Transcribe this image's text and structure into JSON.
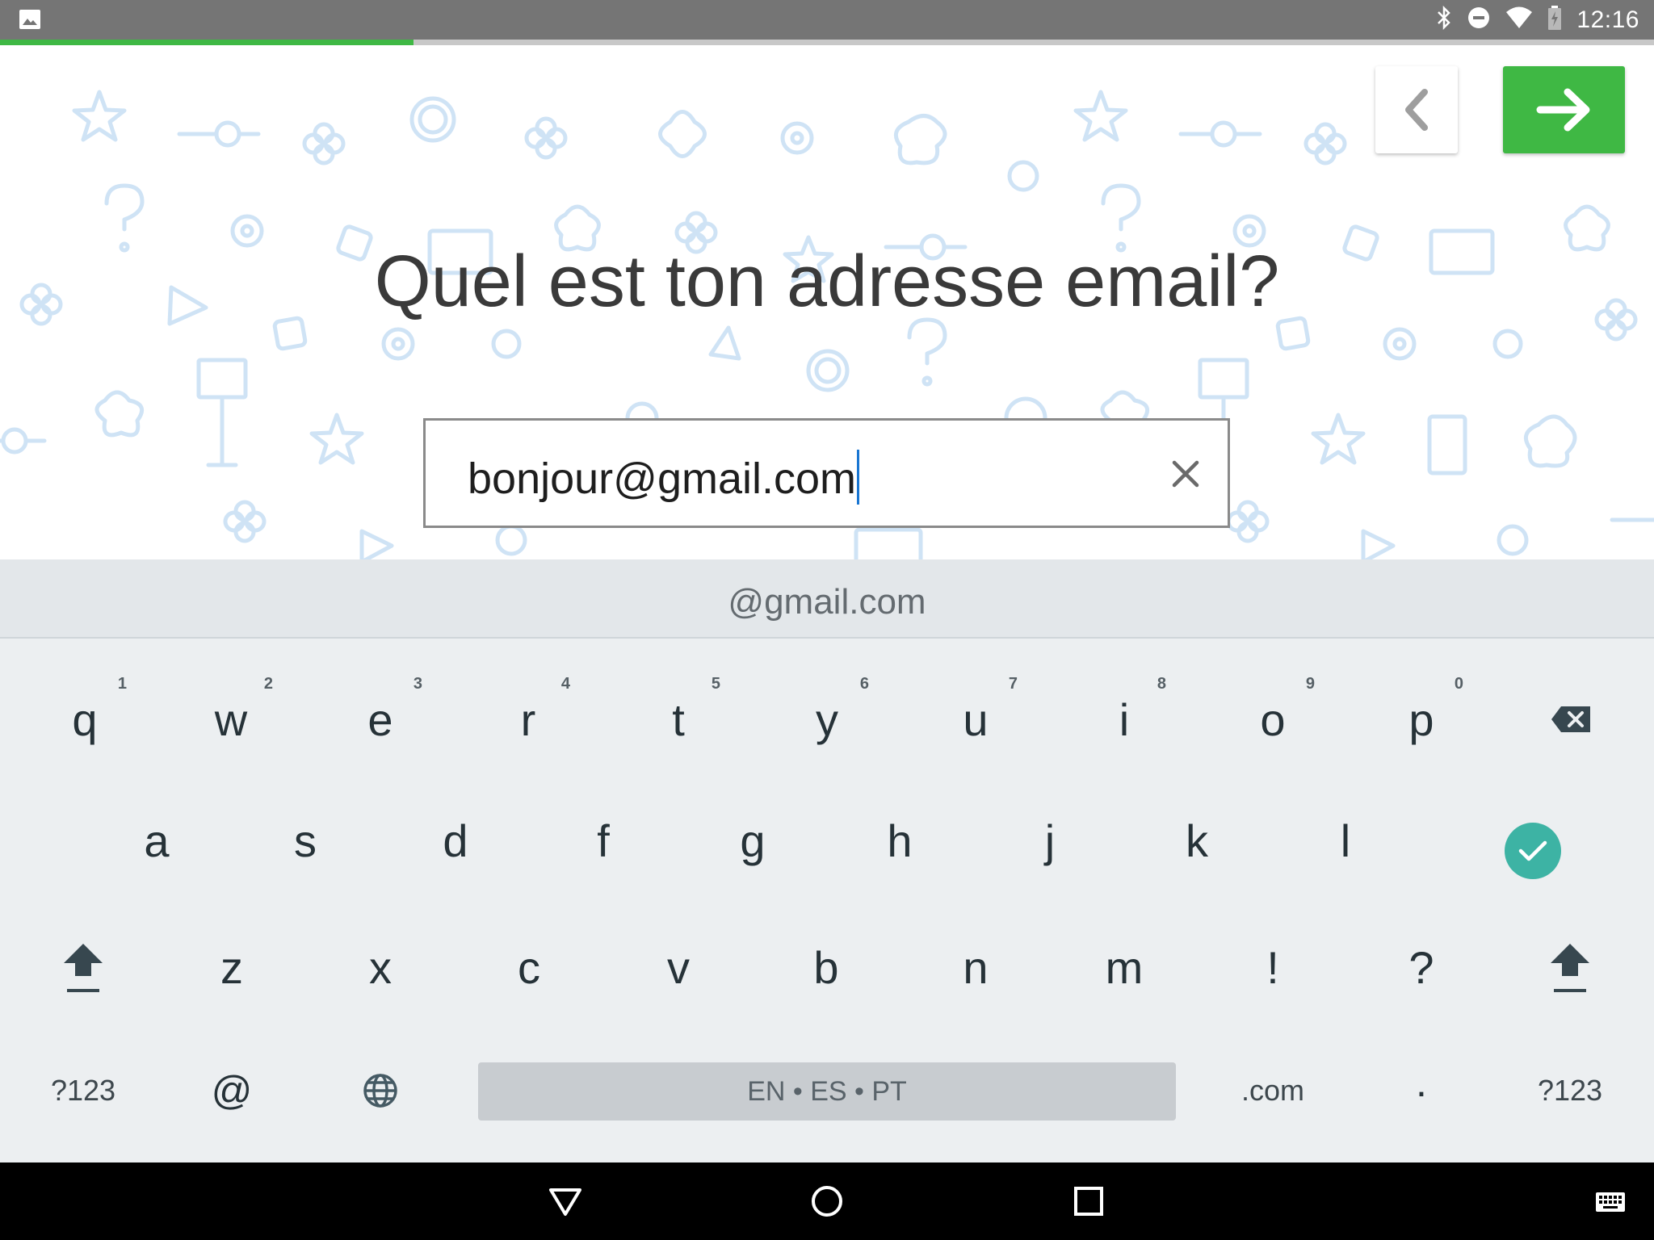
{
  "status_bar": {
    "time": "12:16",
    "icons": [
      "image-icon",
      "bluetooth-icon",
      "do-not-disturb-icon",
      "wifi-icon",
      "battery-charging-icon"
    ]
  },
  "progress": {
    "fraction": 0.25,
    "color": "#3fb844"
  },
  "nav": {
    "back_icon": "chevron-left-icon",
    "next_icon": "arrow-right-icon",
    "next_color": "#3fb844"
  },
  "question": {
    "text": "Quel est ton adresse email?"
  },
  "email": {
    "value": "bonjour@gmail.com",
    "clear_icon": "close-icon"
  },
  "keyboard": {
    "suggestion": "@gmail.com",
    "row1": [
      {
        "label": "q",
        "hint": "1"
      },
      {
        "label": "w",
        "hint": "2"
      },
      {
        "label": "e",
        "hint": "3"
      },
      {
        "label": "r",
        "hint": "4"
      },
      {
        "label": "t",
        "hint": "5"
      },
      {
        "label": "y",
        "hint": "6"
      },
      {
        "label": "u",
        "hint": "7"
      },
      {
        "label": "i",
        "hint": "8"
      },
      {
        "label": "o",
        "hint": "9"
      },
      {
        "label": "p",
        "hint": "0"
      }
    ],
    "row2": [
      "a",
      "s",
      "d",
      "f",
      "g",
      "h",
      "j",
      "k",
      "l"
    ],
    "row3": [
      "z",
      "x",
      "c",
      "v",
      "b",
      "n",
      "m",
      "!",
      "?"
    ],
    "symbols_left": "?123",
    "at": "@",
    "space_label": "EN • ES • PT",
    "dotcom": ".com",
    "period": ".",
    "symbols_right": "?123",
    "done_color": "#3db3a4"
  }
}
